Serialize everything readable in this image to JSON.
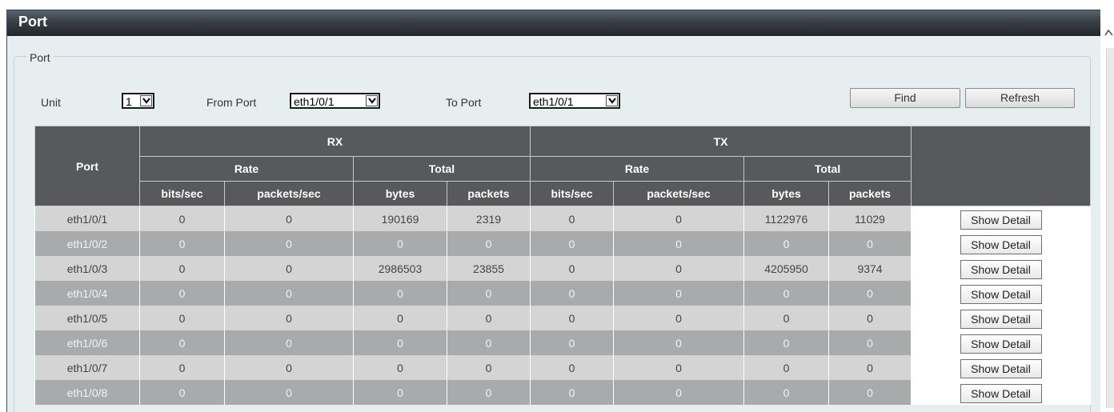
{
  "page": {
    "title": "Port"
  },
  "form": {
    "legend": "Port",
    "unit_label": "Unit",
    "unit_value": "1",
    "from_port_label": "From Port",
    "from_port_value": "eth1/0/1",
    "to_port_label": "To Port",
    "to_port_value": "eth1/0/1",
    "find_label": "Find",
    "refresh_label": "Refresh"
  },
  "table": {
    "port_header": "Port",
    "rx_header": "RX",
    "tx_header": "TX",
    "rate_header": "Rate",
    "total_header": "Total",
    "bits_sec": "bits/sec",
    "packets_sec": "packets/sec",
    "bytes": "bytes",
    "packets": "packets",
    "detail_label": "Show Detail",
    "rows": [
      {
        "port": "eth1/0/1",
        "rx_bits": "0",
        "rx_pps": "0",
        "rx_bytes": "190169",
        "rx_packets": "2319",
        "tx_bits": "0",
        "tx_pps": "0",
        "tx_bytes": "1122976",
        "tx_packets": "11029"
      },
      {
        "port": "eth1/0/2",
        "rx_bits": "0",
        "rx_pps": "0",
        "rx_bytes": "0",
        "rx_packets": "0",
        "tx_bits": "0",
        "tx_pps": "0",
        "tx_bytes": "0",
        "tx_packets": "0"
      },
      {
        "port": "eth1/0/3",
        "rx_bits": "0",
        "rx_pps": "0",
        "rx_bytes": "2986503",
        "rx_packets": "23855",
        "tx_bits": "0",
        "tx_pps": "0",
        "tx_bytes": "4205950",
        "tx_packets": "9374"
      },
      {
        "port": "eth1/0/4",
        "rx_bits": "0",
        "rx_pps": "0",
        "rx_bytes": "0",
        "rx_packets": "0",
        "tx_bits": "0",
        "tx_pps": "0",
        "tx_bytes": "0",
        "tx_packets": "0"
      },
      {
        "port": "eth1/0/5",
        "rx_bits": "0",
        "rx_pps": "0",
        "rx_bytes": "0",
        "rx_packets": "0",
        "tx_bits": "0",
        "tx_pps": "0",
        "tx_bytes": "0",
        "tx_packets": "0"
      },
      {
        "port": "eth1/0/6",
        "rx_bits": "0",
        "rx_pps": "0",
        "rx_bytes": "0",
        "rx_packets": "0",
        "tx_bits": "0",
        "tx_pps": "0",
        "tx_bytes": "0",
        "tx_packets": "0"
      },
      {
        "port": "eth1/0/7",
        "rx_bits": "0",
        "rx_pps": "0",
        "rx_bytes": "0",
        "rx_packets": "0",
        "tx_bits": "0",
        "tx_pps": "0",
        "tx_bytes": "0",
        "tx_packets": "0"
      },
      {
        "port": "eth1/0/8",
        "rx_bits": "0",
        "rx_pps": "0",
        "rx_bytes": "0",
        "rx_packets": "0",
        "tx_bits": "0",
        "tx_pps": "0",
        "tx_bytes": "0",
        "tx_packets": "0"
      }
    ]
  },
  "icons": {
    "dropdown": "chevron-down-icon",
    "scroll_up": "scroll-up-arrow-icon"
  },
  "colors": {
    "header_bg": "#58595b",
    "row_light": "#d4d4d4",
    "row_dark": "#a9aaac",
    "panel_bg": "#e6eef0",
    "title_bg": "#2e3338"
  }
}
